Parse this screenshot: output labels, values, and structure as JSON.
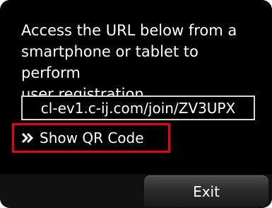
{
  "dialog": {
    "message": "Access the URL below from a\nsmartphone or tablet to perform\nuser registration.",
    "url": "cl-ev1.c-ij.com/join/ZV3UPX",
    "show_qr_label": "Show QR Code",
    "show_qr_icon": "double-chevron-right-icon",
    "exit_label": "Exit"
  },
  "colors": {
    "background": "#000000",
    "text": "#ffffff",
    "highlight_border": "#e8001c",
    "url_box_border": "#d8d8d8"
  }
}
